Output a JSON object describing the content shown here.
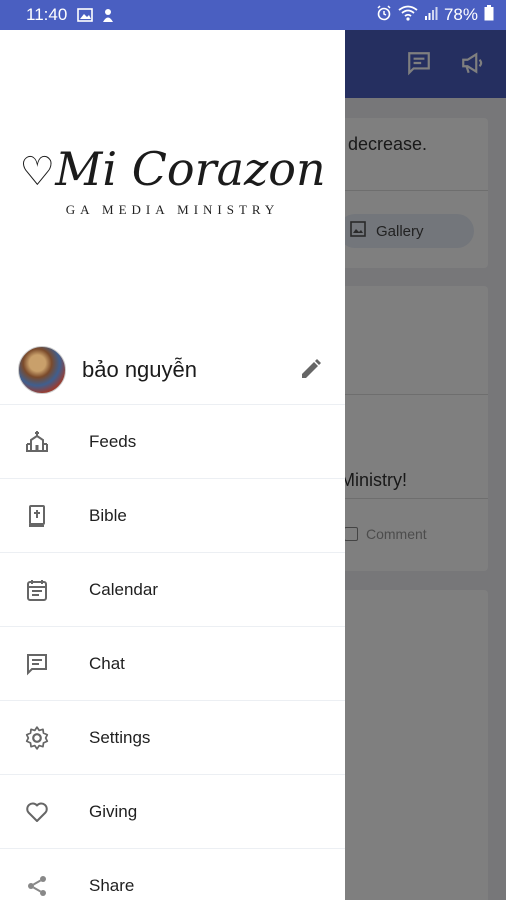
{
  "status_bar": {
    "time": "11:40",
    "battery": "78%"
  },
  "background": {
    "text_decrease": "decrease.",
    "gallery_label": "Gallery",
    "text_ministry": "Ministry!",
    "comment_label": "Comment"
  },
  "drawer": {
    "logo_title": "Mi Corazon",
    "logo_subtitle": "GA MEDIA MINISTRY",
    "user_name": "bảo nguyễn",
    "items": [
      {
        "label": "Feeds",
        "icon": "church-icon"
      },
      {
        "label": "Bible",
        "icon": "bible-icon"
      },
      {
        "label": "Calendar",
        "icon": "calendar-icon"
      },
      {
        "label": "Chat",
        "icon": "chat-icon"
      },
      {
        "label": "Settings",
        "icon": "settings-icon"
      },
      {
        "label": "Giving",
        "icon": "heart-icon"
      },
      {
        "label": "Share",
        "icon": "share-icon"
      }
    ]
  },
  "colors": {
    "primary": "#4a5fc1",
    "scrim": "rgba(0,0,0,0.5)",
    "icon_gray": "#666666"
  }
}
